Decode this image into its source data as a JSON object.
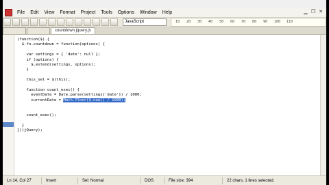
{
  "menu": {
    "items": [
      "File",
      "Edit",
      "View",
      "Format",
      "Project",
      "Tools",
      "Options",
      "Window",
      "Help"
    ]
  },
  "toolbar": {
    "language": "JavaScript"
  },
  "ruler": {
    "marks": [
      "10",
      "20",
      "30",
      "40",
      "50",
      "60",
      "70",
      "80",
      "90",
      "100",
      "110"
    ]
  },
  "tabs": [
    {
      "label": ""
    },
    {
      "label": ""
    },
    {
      "label": "countdown.jquery.js"
    }
  ],
  "code": {
    "lines": [
      "(function($) {",
      "  $.fn.countdown = function(options) {",
      "",
      "    var settings = { 'date': null };",
      "    if (options) {",
      "      $.extend(settings, options);",
      "    }",
      "",
      "    this_sel = $(this);",
      "",
      "    function count_exec() {",
      "      eventDate = Date.parse(settings['date']) / 1000;",
      "      currentDate = ",
      "",
      "",
      "    count_exec();",
      "",
      "  }",
      "})(jQuery);"
    ],
    "selected_text": "Math.floor($.now() / 1000);"
  },
  "status": {
    "position": "Ln 14, Col 27",
    "mode": "Insert",
    "selection_mode": "Sel: Normal",
    "format": "DOS",
    "file_size": "File size: 394",
    "selection_info": "22 chars, 1 lines selected."
  }
}
